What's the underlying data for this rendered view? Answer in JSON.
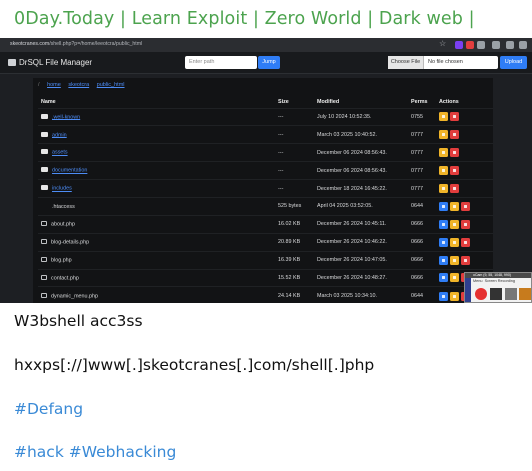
{
  "header": {
    "title": "0Day.Today | Learn Exploit | Zero World | Dark web |"
  },
  "browser": {
    "url_prefix": "skeotcranes.com",
    "url_rest": "/shell.php?p=/home/leeotcra/public_html",
    "star_icon": "star-icon",
    "ext_colors": [
      "#7a3ff0",
      "#e23d3d",
      "#9aa0a6",
      "#9aa0a6",
      "#9aa0a6",
      "#9aa0a6"
    ]
  },
  "app": {
    "title": "DrSQL File Manager",
    "path_placeholder": "Enter path",
    "jump_label": "Jump",
    "choose_file_label": "Choose File",
    "no_file_label": "No file chosen",
    "upload_label": "Upload"
  },
  "breadcrumb": [
    "home",
    "skeotcra",
    "public_html"
  ],
  "table": {
    "headers": {
      "name": "Name",
      "size": "Size",
      "modified": "Modified",
      "perms": "Perms",
      "actions": "Actions"
    },
    "rows": [
      {
        "type": "folder",
        "name": ".well-known",
        "size": "---",
        "modified": "July 10 2024 10:52:35.",
        "perms": "0755",
        "actions": [
          "edit",
          "del"
        ]
      },
      {
        "type": "folder",
        "name": "admin",
        "size": "---",
        "modified": "March 03 2025 10:40:52.",
        "perms": "0777",
        "actions": [
          "edit",
          "del"
        ]
      },
      {
        "type": "folder",
        "name": "assets",
        "size": "---",
        "modified": "December 06 2024 08:56:43.",
        "perms": "0777",
        "actions": [
          "edit",
          "del"
        ]
      },
      {
        "type": "folder",
        "name": "documentation",
        "size": "---",
        "modified": "December 06 2024 08:56:43.",
        "perms": "0777",
        "actions": [
          "edit",
          "del"
        ]
      },
      {
        "type": "folder",
        "name": "includes",
        "size": "---",
        "modified": "December 18 2024 16:45:22.",
        "perms": "0777",
        "actions": [
          "edit",
          "del"
        ]
      },
      {
        "type": "config",
        "name": ".htaccess",
        "size": "525 bytes",
        "modified": "April 04 2025 03:52:05.",
        "perms": "0644",
        "actions": [
          "open",
          "edit",
          "del"
        ]
      },
      {
        "type": "file",
        "name": "about.php",
        "size": "16.02 KB",
        "modified": "December 26 2024 10:45:11.",
        "perms": "0666",
        "actions": [
          "open",
          "edit",
          "del"
        ]
      },
      {
        "type": "file",
        "name": "blog-details.php",
        "size": "20.89 KB",
        "modified": "December 26 2024 10:46:22.",
        "perms": "0666",
        "actions": [
          "open",
          "edit",
          "del"
        ]
      },
      {
        "type": "file",
        "name": "blog.php",
        "size": "16.39 KB",
        "modified": "December 26 2024 10:47:05.",
        "perms": "0666",
        "actions": [
          "open",
          "edit",
          "del"
        ]
      },
      {
        "type": "file",
        "name": "contact.php",
        "size": "15.52 KB",
        "modified": "December 26 2024 10:48:27.",
        "perms": "0666",
        "actions": [
          "open",
          "edit",
          "del"
        ]
      },
      {
        "type": "file",
        "name": "dynamic_menu.php",
        "size": "24.14 KB",
        "modified": "March 03 2025 10:34:10.",
        "perms": "0644",
        "actions": [
          "open",
          "edit",
          "del"
        ]
      }
    ]
  },
  "recorder": {
    "title": "oCam (9, 55, 1048, 990)",
    "menu_label": "Menu",
    "tab_label": "Screen Recording"
  },
  "post": {
    "line1": "W3bshell acc3ss",
    "line2": "hxxps[://]www[.]skeotcranes[.]com/shell[.]php",
    "line3": "#Defang",
    "line4": "#hack #Webhacking"
  }
}
